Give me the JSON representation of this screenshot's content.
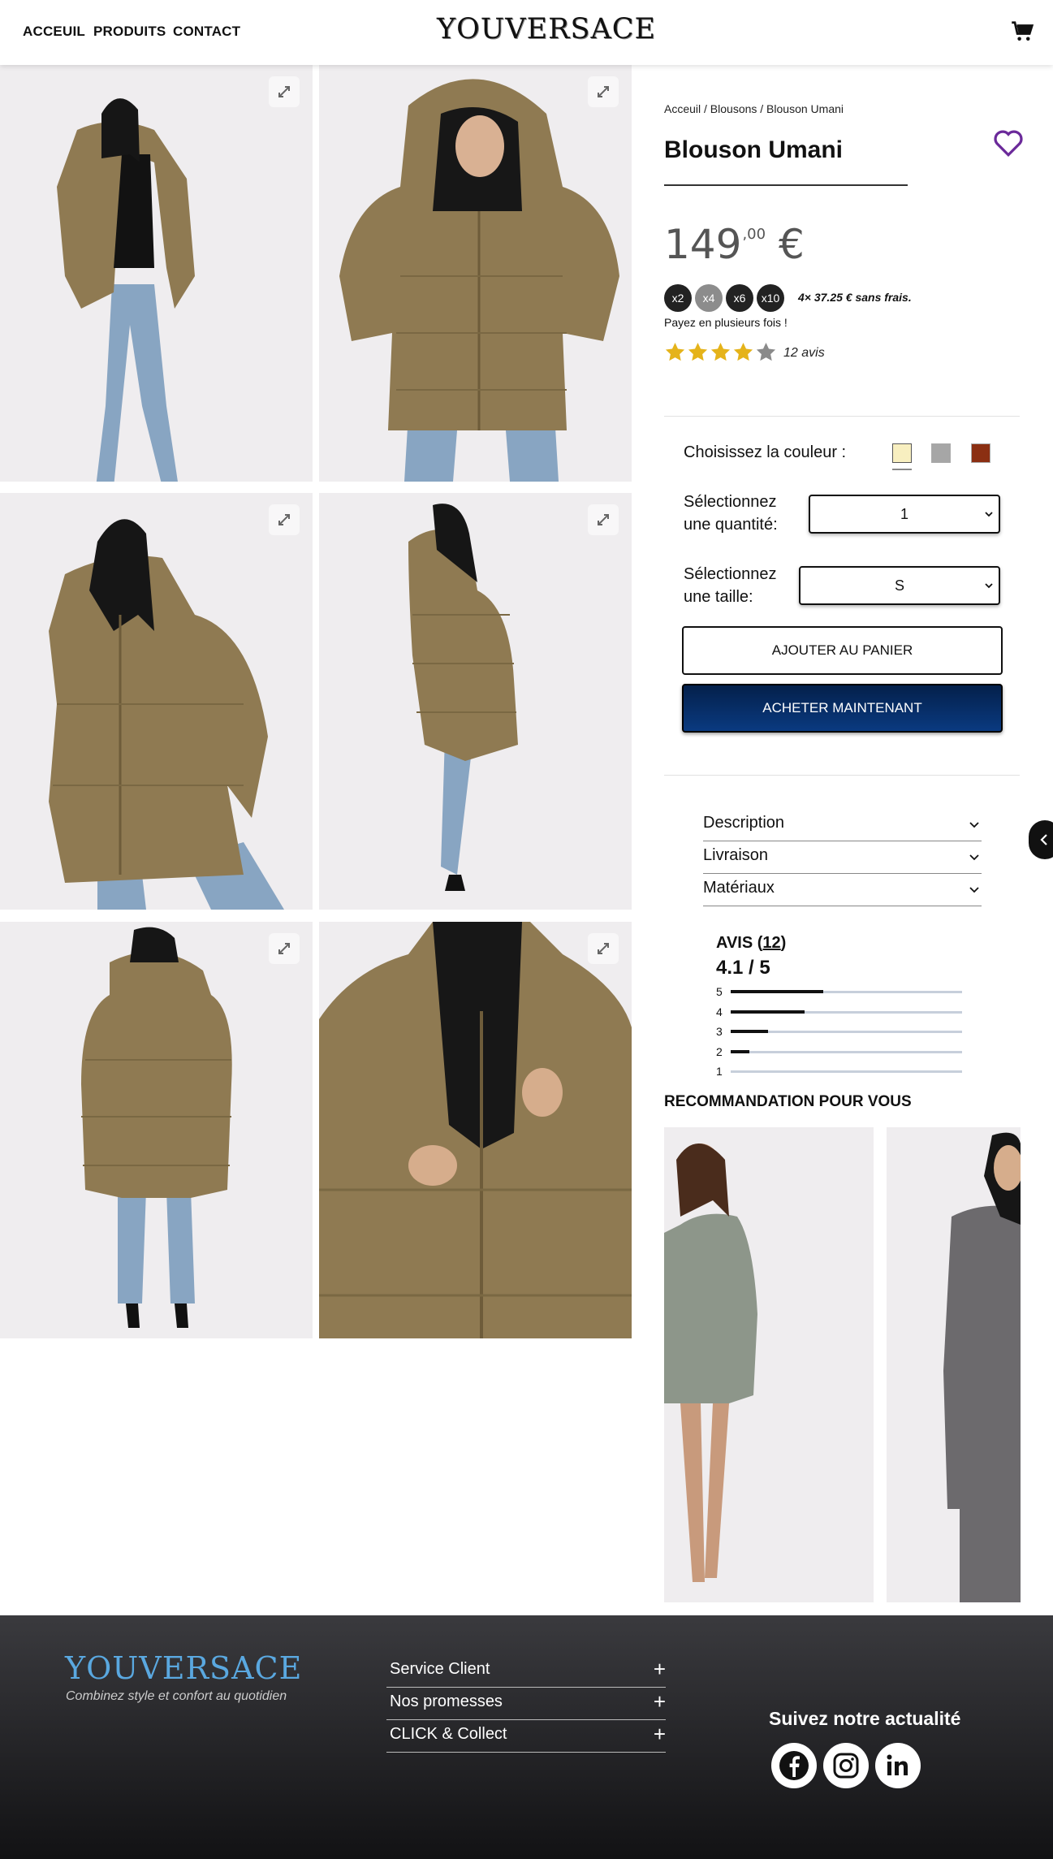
{
  "header": {
    "nav": [
      "ACCEUIL",
      "PRODUITS",
      "CONTACT"
    ],
    "logo": "YOUVERSACE",
    "cart_icon": "cart-icon"
  },
  "gallery": {
    "jacket_color": "#8f7a52",
    "expand_icon": "expand-icon",
    "images": 6
  },
  "product": {
    "breadcrumb": "Acceuil / Blousons / Blouson Umani",
    "title": "Blouson Umani",
    "price_main": "149",
    "price_cents": ",00",
    "price_currency": "€",
    "installments": [
      "x2",
      "x4",
      "x6",
      "x10"
    ],
    "installments_text": "4× 37.25 € sans frais.",
    "pay_text": "Payez en plusieurs fois !",
    "rating": 4,
    "rating_max": 5,
    "reviews_count": "12 avis",
    "favorite_icon": "heart-icon"
  },
  "options": {
    "color_label": "Choisissez la couleur :",
    "colors": [
      "#f8efc0",
      "#a6a6a6",
      "#8b2f12"
    ],
    "selected_color": 0,
    "quantity_label_1": "Sélectionnez",
    "quantity_label_2": "une quantité:",
    "quantity_value": "1",
    "size_label_1": "Sélectionnez",
    "size_label_2": "une taille:",
    "size_value": "S",
    "add_to_cart": "AJOUTER AU PANIER",
    "buy_now": "ACHETER MAINTENANT"
  },
  "accordions": [
    "Description",
    "Livraison",
    "Matériaux"
  ],
  "reviews": {
    "title_prefix": "AVIS (",
    "title_count": "12",
    "title_suffix": ")",
    "score": "4.1 / 5",
    "distribution": [
      {
        "label": "5",
        "fraction": 0.4
      },
      {
        "label": "4",
        "fraction": 0.32
      },
      {
        "label": "3",
        "fraction": 0.16
      },
      {
        "label": "2",
        "fraction": 0.08
      },
      {
        "label": "1",
        "fraction": 0.0
      }
    ]
  },
  "recommendations": {
    "title": "RECOMMANDATION POUR VOUS"
  },
  "footer": {
    "logo": "YOUVERSACE",
    "tagline": "Combinez style et confort au quotidien",
    "links": [
      "Service Client",
      "Nos promesses",
      "CLICK & Collect"
    ],
    "follow": "Suivez notre actualité",
    "socials": [
      "facebook-icon",
      "instagram-icon",
      "linkedin-icon"
    ]
  }
}
